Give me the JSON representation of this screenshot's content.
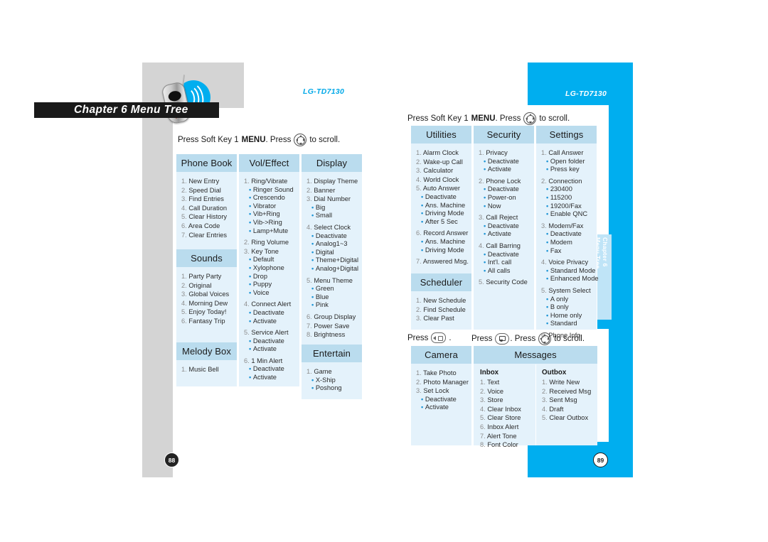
{
  "document": {
    "model": "LG-TD7130",
    "chapter_bar": "Chapter 6  Menu Tree",
    "side_tab_line1": "Chapter 6",
    "side_tab_line2": "Menu Tree",
    "page_left": "88",
    "page_right": "89",
    "accent_color": "#00aeef",
    "header_color": "#badcee",
    "column_bg": "#e4f2fb"
  },
  "instructions": {
    "menu_prefix": "Press Soft Key 1",
    "menu_bold": "MENU",
    "menu_mid": ". Press",
    "menu_suffix": "to scroll.",
    "camera_prefix": "Press",
    "camera_suffix": ".",
    "messages_prefix": "Press",
    "messages_mid": ". Press",
    "messages_suffix": "to scroll."
  },
  "left_page": {
    "columns": [
      {
        "title": "Phone Book",
        "items": [
          {
            "num": "1.",
            "label": "New Entry"
          },
          {
            "num": "2.",
            "label": "Speed Dial"
          },
          {
            "num": "3.",
            "label": "Find Entries"
          },
          {
            "num": "4.",
            "label": "Call Duration"
          },
          {
            "num": "5.",
            "label": "Clear History"
          },
          {
            "num": "6.",
            "label": "Area Code"
          },
          {
            "num": "7.",
            "label": "Clear Entries"
          }
        ]
      },
      {
        "title": "Sounds",
        "items": [
          {
            "num": "1.",
            "label": "Party Party"
          },
          {
            "num": "2.",
            "label": "Original"
          },
          {
            "num": "3.",
            "label": "Global Voices"
          },
          {
            "num": "4.",
            "label": "Morning Dew"
          },
          {
            "num": "5.",
            "label": "Enjoy Today!"
          },
          {
            "num": "6.",
            "label": "Fantasy Trip"
          }
        ]
      },
      {
        "title": "Melody Box",
        "items": [
          {
            "num": "1.",
            "label": "Music Bell"
          }
        ]
      },
      {
        "title": "Vol/Effect",
        "items": [
          {
            "num": "1.",
            "label": "Ring/Vibrate",
            "subs": [
              "Ringer Sound",
              "Crescendo",
              "Vibrator",
              "Vib+Ring",
              "Vib->Ring",
              "Lamp+Mute"
            ]
          },
          {
            "num": "2.",
            "label": "Ring Volume"
          },
          {
            "num": "3.",
            "label": "Key Tone",
            "subs": [
              "Default",
              "Xylophone",
              "Drop",
              "Puppy",
              "Voice"
            ]
          },
          {
            "num": "4.",
            "label": "Connect Alert",
            "subs": [
              "Deactivate",
              "Activate"
            ]
          },
          {
            "num": "5.",
            "label": "Service Alert",
            "subs": [
              "Deactivate",
              "Activate"
            ]
          },
          {
            "num": "6.",
            "label": "1 Min Alert",
            "subs": [
              "Deactivate",
              "Activate"
            ]
          }
        ]
      },
      {
        "title": "Display",
        "items": [
          {
            "num": "1.",
            "label": "Display Theme"
          },
          {
            "num": "2.",
            "label": "Banner"
          },
          {
            "num": "3.",
            "label": "Dial Number",
            "subs": [
              "Big",
              "Small"
            ]
          },
          {
            "num": "4.",
            "label": "Select Clock",
            "subs": [
              "Deactivate",
              "Analog1~3",
              "Digital",
              "Theme+Digital",
              "Analog+Digital"
            ]
          },
          {
            "num": "5.",
            "label": "Menu Theme",
            "subs": [
              "Green",
              "Blue",
              "Pink"
            ]
          },
          {
            "num": "6.",
            "label": "Group Display"
          },
          {
            "num": "7.",
            "label": "Power Save"
          },
          {
            "num": "8.",
            "label": "Brightness"
          }
        ]
      },
      {
        "title": "Entertain",
        "items": [
          {
            "num": "1.",
            "label": "Game",
            "subs": [
              "X-Ship",
              "Poshong"
            ]
          }
        ]
      }
    ]
  },
  "right_page": {
    "columns": [
      {
        "title": "Utilities",
        "items": [
          {
            "num": "1.",
            "label": "Alarm Clock"
          },
          {
            "num": "2.",
            "label": "Wake-up Call"
          },
          {
            "num": "3.",
            "label": "Calculator"
          },
          {
            "num": "4.",
            "label": "World Clock"
          },
          {
            "num": "5.",
            "label": "Auto Answer",
            "subs": [
              "Deactivate",
              "Ans. Machine",
              "Driving Mode",
              "After 5 Sec"
            ]
          },
          {
            "num": "6.",
            "label": "Record Answer",
            "subs": [
              "Ans. Machine",
              "Driving Mode"
            ]
          },
          {
            "num": "7.",
            "label": "Answered Msg."
          }
        ]
      },
      {
        "title": "Scheduler",
        "items": [
          {
            "num": "1.",
            "label": "New Schedule"
          },
          {
            "num": "2.",
            "label": "Find Schedule"
          },
          {
            "num": "3.",
            "label": "Clear Past"
          }
        ]
      },
      {
        "title": "Security",
        "items": [
          {
            "num": "1.",
            "label": "Privacy",
            "subs": [
              "Deactivate",
              "Activate"
            ]
          },
          {
            "num": "2.",
            "label": "Phone Lock",
            "subs": [
              "Deactivate",
              "Power-on",
              "Now"
            ]
          },
          {
            "num": "3.",
            "label": "Call Reject",
            "subs": [
              "Deactivate",
              "Activate"
            ]
          },
          {
            "num": "4.",
            "label": "Call Barring",
            "subs": [
              "Deactivate",
              "Int'l. call",
              "All calls"
            ]
          },
          {
            "num": "5.",
            "label": "Security Code"
          }
        ]
      },
      {
        "title": "Settings",
        "items": [
          {
            "num": "1.",
            "label": "Call Answer",
            "subs": [
              "Open folder",
              "Press key"
            ]
          },
          {
            "num": "2.",
            "label": "Connection",
            "subs": [
              "230400",
              "115200",
              "19200/Fax",
              "Enable QNC"
            ]
          },
          {
            "num": "3.",
            "label": "Modem/Fax",
            "subs": [
              "Deactivate",
              "Modem",
              "Fax"
            ]
          },
          {
            "num": "4.",
            "label": "Voice Privacy",
            "subs": [
              "Standard Mode",
              "Enhanced Mode"
            ]
          },
          {
            "num": "5.",
            "label": "System Select",
            "subs": [
              "A only",
              "B only",
              "Home only",
              "Standard"
            ]
          },
          {
            "num": "6.",
            "label": "Phone Info"
          }
        ]
      },
      {
        "title": "Camera",
        "items": [
          {
            "num": "1.",
            "label": "Take Photo"
          },
          {
            "num": "2.",
            "label": "Photo Manager"
          },
          {
            "num": "3.",
            "label": "Set Lock",
            "subs": [
              "Deactivate",
              "Activate"
            ]
          }
        ]
      }
    ],
    "messages": {
      "title": "Messages",
      "inbox": {
        "title": "Inbox",
        "items": [
          {
            "num": "1.",
            "label": "Text"
          },
          {
            "num": "2.",
            "label": "Voice"
          },
          {
            "num": "3.",
            "label": "Store"
          },
          {
            "num": "4.",
            "label": "Clear Inbox"
          },
          {
            "num": "5.",
            "label": "Clear Store"
          },
          {
            "num": "6.",
            "label": "Inbox Alert"
          },
          {
            "num": "7.",
            "label": "Alert Tone"
          },
          {
            "num": "8.",
            "label": "Font Color"
          }
        ]
      },
      "outbox": {
        "title": "Outbox",
        "items": [
          {
            "num": "1.",
            "label": "Write New"
          },
          {
            "num": "2.",
            "label": "Received Msg"
          },
          {
            "num": "3.",
            "label": "Sent Msg"
          },
          {
            "num": "4.",
            "label": "Draft"
          },
          {
            "num": "5.",
            "label": "Clear Outbox"
          }
        ]
      }
    }
  }
}
